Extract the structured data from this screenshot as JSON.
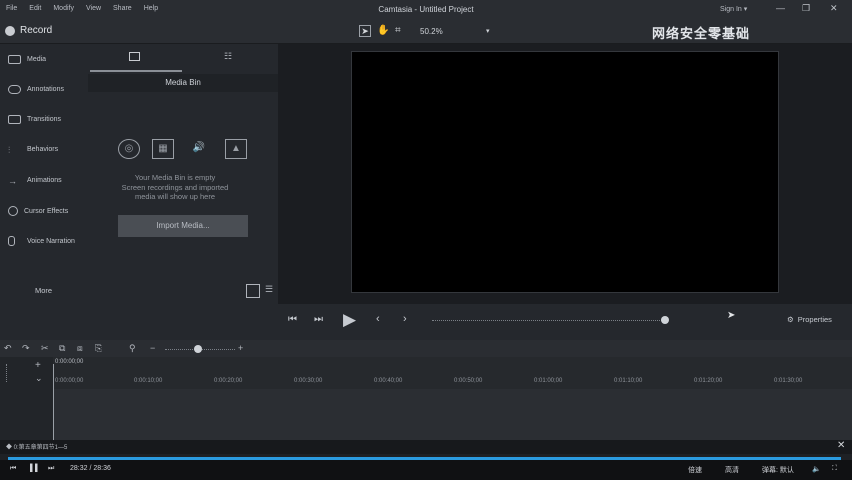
{
  "menubar": {
    "items": [
      "File",
      "Edit",
      "Modify",
      "View",
      "Share",
      "Help"
    ],
    "title": "Camtasia - Untitled Project",
    "signin": "Sign In ▾"
  },
  "toolbar": {
    "record_label": "Record",
    "zoom": "50.2%",
    "watermark": "网络安全零基础"
  },
  "left_nav": {
    "items": [
      "Media",
      "Annotations",
      "Transitions",
      "Behaviors",
      "Animations",
      "Cursor Effects",
      "Voice Narration"
    ],
    "more_label": "More"
  },
  "media_bin": {
    "header": "Media Bin",
    "empty_line1": "Your Media Bin is empty",
    "empty_line2": "Screen recordings and imported",
    "empty_line3": "media will show up here",
    "import_label": "Import Media..."
  },
  "playback": {
    "properties_label": "Properties"
  },
  "timeline": {
    "playhead_time": "0:00:00;00",
    "ticks": [
      "0:00:00;00",
      "0:00:10;00",
      "0:00:20;00",
      "0:00:30;00",
      "0:00:40;00",
      "0:00:50;00",
      "0:01:00;00",
      "0:01:10;00",
      "0:01:20;00",
      "0:01:30;00"
    ]
  },
  "player": {
    "title": "◆ 0:第五章第四节1—5",
    "time": "28:32 / 28:36",
    "controls": [
      "倍速",
      "高清",
      "弹幕: 默认"
    ]
  },
  "colors": {
    "accent": "#2b9be0",
    "canvas": "#000000",
    "panel": "#25282d"
  }
}
